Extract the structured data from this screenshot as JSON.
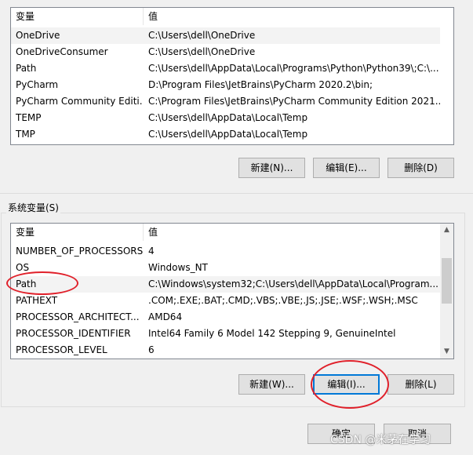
{
  "user_vars": {
    "columns": [
      "变量",
      "值"
    ],
    "rows": [
      {
        "name": "OneDrive",
        "value": "C:\\Users\\dell\\OneDrive"
      },
      {
        "name": "OneDriveConsumer",
        "value": "C:\\Users\\dell\\OneDrive"
      },
      {
        "name": "Path",
        "value": "C:\\Users\\dell\\AppData\\Local\\Programs\\Python\\Python39\\;C:\\..."
      },
      {
        "name": "PyCharm",
        "value": "D:\\Program Files\\JetBrains\\PyCharm 2020.2\\bin;"
      },
      {
        "name": "PyCharm Community Editi...",
        "value": "C:\\Program Files\\JetBrains\\PyCharm Community Edition 2021...."
      },
      {
        "name": "TEMP",
        "value": "C:\\Users\\dell\\AppData\\Local\\Temp"
      },
      {
        "name": "TMP",
        "value": "C:\\Users\\dell\\AppData\\Local\\Temp"
      }
    ],
    "buttons": {
      "new": "新建(N)...",
      "edit": "编辑(E)...",
      "delete": "删除(D)"
    }
  },
  "system_vars": {
    "group_label": "系统变量(S)",
    "columns": [
      "变量",
      "值"
    ],
    "rows": [
      {
        "name": "NUMBER_OF_PROCESSORS",
        "value": "4"
      },
      {
        "name": "OS",
        "value": "Windows_NT"
      },
      {
        "name": "Path",
        "value": "C:\\Windows\\system32;C:\\Users\\dell\\AppData\\Local\\Program..."
      },
      {
        "name": "PATHEXT",
        "value": ".COM;.EXE;.BAT;.CMD;.VBS;.VBE;.JS;.JSE;.WSF;.WSH;.MSC"
      },
      {
        "name": "PROCESSOR_ARCHITECT...",
        "value": "AMD64"
      },
      {
        "name": "PROCESSOR_IDENTIFIER",
        "value": "Intel64 Family 6 Model 142 Stepping 9, GenuineIntel"
      },
      {
        "name": "PROCESSOR_LEVEL",
        "value": "6"
      }
    ],
    "selected_row": "Path",
    "buttons": {
      "new": "新建(W)...",
      "edit": "编辑(I)...",
      "delete": "删除(L)"
    }
  },
  "dialog_buttons": {
    "ok": "确定",
    "cancel": "取消"
  },
  "watermark": "CSDN @米茅在学习",
  "annotation_color": "#e0202a"
}
